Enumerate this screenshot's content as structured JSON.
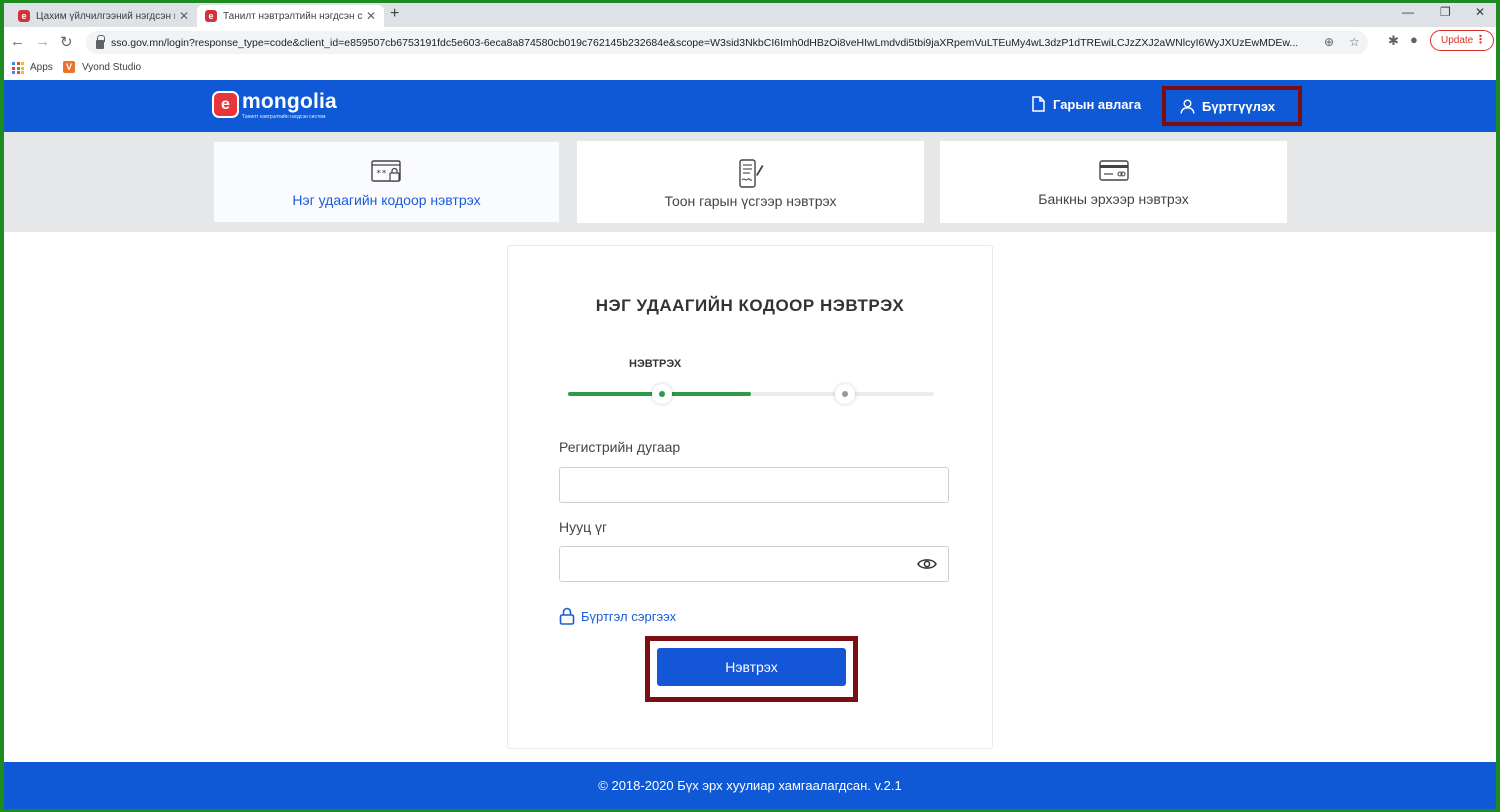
{
  "browser": {
    "tabs": [
      {
        "title": "Цахим үйлчилгээний нэгдсэн п",
        "active": false
      },
      {
        "title": "Танилт нэвтрэлтийн нэгдсэн си",
        "active": true
      }
    ],
    "new_tab": "+",
    "url": "sso.gov.mn/login?response_type=code&client_id=e859507cb6753191fdc5e603-6eca8a874580cb019c762145b232684e&scope=W3sid3NkbCI6Imh0dHBzOi8veHIwLmdvdi5tbi9jaXRpemVuLTEuMy4wL3dzP1dTREwiLCJzZXJ2aWNlcyI6WyJXUzEwMDEw...",
    "update_label": "Update",
    "bookmarks": [
      {
        "label": "Apps",
        "icon": "apps-grid-icon"
      },
      {
        "label": "Vyond Studio",
        "icon": "vyond-icon"
      }
    ]
  },
  "header": {
    "logo_letter": "e",
    "logo_name": "mongolia",
    "logo_tagline": "Танилт нэвтрэлтийн нэгдсэн систем",
    "manual_label": "Гарын авлага",
    "register_label": "Бүртгүүлэх",
    "bg_color": "#1059d6"
  },
  "methods": [
    {
      "label": "Нэг удаагийн кодоор нэвтрэх",
      "icon": "otp-code-icon",
      "active": true
    },
    {
      "label": "Тоон гарын үсгээр нэвтрэх",
      "icon": "digital-signature-icon",
      "active": false
    },
    {
      "label": "Банкны эрхээр нэвтрэх",
      "icon": "bank-card-icon",
      "active": false
    }
  ],
  "login": {
    "title": "НЭГ УДААГИЙН КОДООР НЭВТРЭХ",
    "step_label": "НЭВТРЭХ",
    "progress_fraction": 0.5,
    "register_number_label": "Регистрийн дугаар",
    "register_number_value": "",
    "password_label": "Нууц үг",
    "password_value": "",
    "recover_label": "Бүртгэл сэргээх",
    "submit_label": "Нэвтрэх",
    "accent_color": "#1456d8",
    "progress_color": "#2e9a46"
  },
  "footer": {
    "text": "© 2018-2020 Бүх эрх хуулиар хамгаалагдсан. v.2.1"
  }
}
